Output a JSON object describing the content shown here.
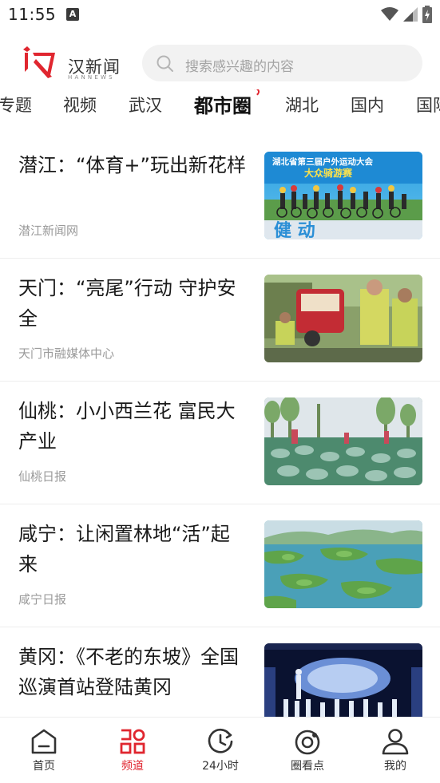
{
  "status": {
    "time": "11:55",
    "notif_letter": "A"
  },
  "header": {
    "logo_cn": "汉新闻",
    "logo_en": "HANNEWS",
    "search_placeholder": "搜索感兴趣的内容"
  },
  "tabs": [
    {
      "label": "专题",
      "active": false
    },
    {
      "label": "视频",
      "active": false
    },
    {
      "label": "武汉",
      "active": false
    },
    {
      "label": "都市圈",
      "active": true
    },
    {
      "label": "湖北",
      "active": false
    },
    {
      "label": "国内",
      "active": false
    },
    {
      "label": "国际",
      "active": false
    }
  ],
  "news": [
    {
      "title": "潜江：“体育+”玩出新花样",
      "source": "潜江新闻网",
      "image": "banner-image",
      "image_text": {
        "line1": "湖北省第三届户外运动大会",
        "line2": "大众骑游赛",
        "bottom": "健 动"
      }
    },
    {
      "title": "天门：“亮尾”行动 守护安全",
      "source": "天门市融媒体中心",
      "image": "officers-image"
    },
    {
      "title": "仙桃：小小西兰花 富民大产业",
      "source": "仙桃日报",
      "image": "field-image"
    },
    {
      "title": "咸宁：让闲置林地“活”起来",
      "source": "咸宁日报",
      "image": "lake-image"
    },
    {
      "title": "黄冈：《不老的东坡》全国巡演首站登陆黄冈",
      "source": "",
      "image": "stage-image"
    }
  ],
  "bottom_nav": [
    {
      "label": "首页",
      "icon": "home-icon",
      "active": false
    },
    {
      "label": "频道",
      "icon": "channel-icon",
      "active": true
    },
    {
      "label": "24小时",
      "icon": "clock-icon",
      "active": false
    },
    {
      "label": "圈看点",
      "icon": "target-icon",
      "active": false
    },
    {
      "label": "我的",
      "icon": "user-icon",
      "active": false
    }
  ],
  "colors": {
    "accent": "#e0262f",
    "text": "#1a1a1a",
    "muted": "#9a9a9a",
    "search_bg": "#f2f2f2"
  }
}
